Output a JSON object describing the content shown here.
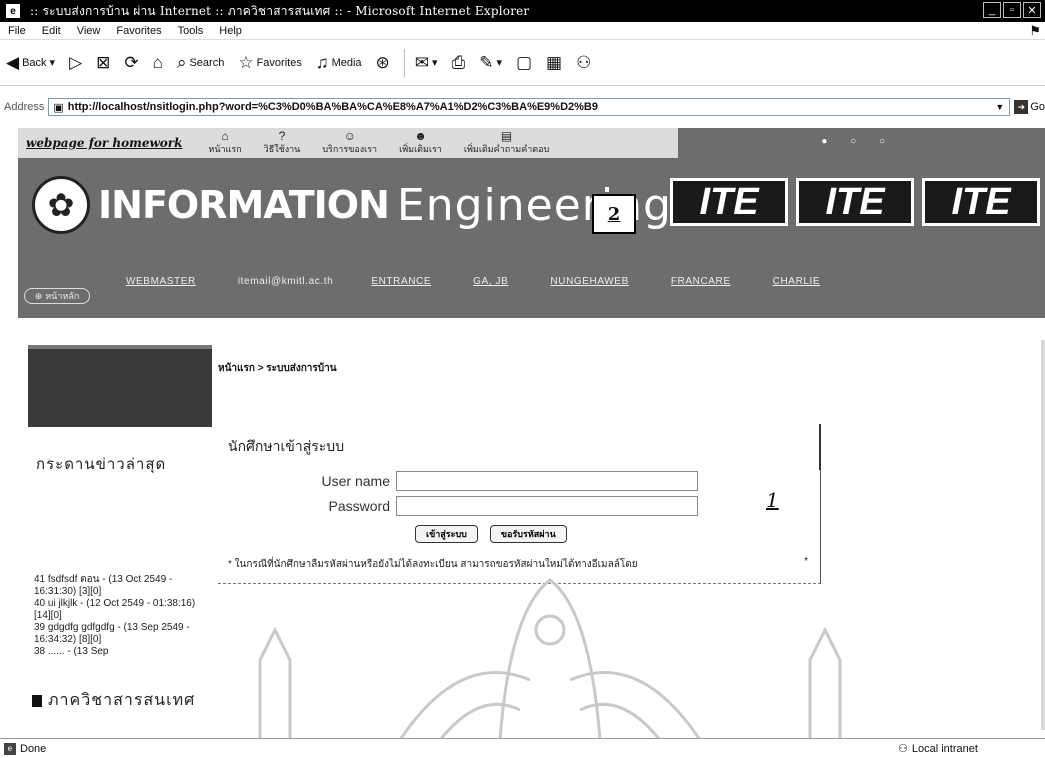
{
  "window": {
    "title": ":: ระบบส่งการบ้าน ผ่าน Internet :: ภาควิชาสารสนเทศ :: - Microsoft Internet Explorer",
    "app_icon_glyph": "e",
    "controls": [
      "_",
      "▫",
      "✕"
    ]
  },
  "menubar": {
    "items": [
      "File",
      "Edit",
      "View",
      "Favorites",
      "Tools",
      "Help"
    ]
  },
  "toolbar": {
    "back_label": "Back",
    "search_label": "Search",
    "favorites_label": "Favorites",
    "media_label": "Media"
  },
  "address": {
    "label": "Address",
    "url": "http://localhost/nsitlogin.php?word=%C3%D0%BA%BA%CA%E8%A7%A1%D2%C3%BA%E9%D2%B9",
    "go_label": "Go"
  },
  "banner": {
    "site_logo": "webpage for homework",
    "nav": [
      "หน้าแรก",
      "วิธีใช้งาน",
      "บริการของเรา",
      "เพิ่มเติมเรา",
      "เพิ่มเติมคำถามคำตอบ"
    ],
    "title_left": "INFORMATION",
    "title_right": "Engineering",
    "annotation_box": "2",
    "ite_blocks": [
      "ITE",
      "ITE",
      "ITE"
    ],
    "links": [
      "WEBMASTER",
      "ENTRANCE",
      "GA, JB",
      "NUNGEHAWEB",
      "FRANCARE",
      "CHARLIE"
    ],
    "email": "itemail@kmitl.ac.th",
    "main_button": "หน้าหลัก"
  },
  "breadcrumb": "หน้าแรก > ระบบส่งการบ้าน",
  "sidebar": {
    "news_heading": "กระดานข่าวล่าสุด",
    "news_items": [
      "41 fsdfsdf ตอน - (13 Oct 2549 - 16:31:30) [3][0]",
      "40 ui jlkjlk - (12 Oct 2549 - 01:38:16) [14][0]",
      "39 gdgdfg gdfgdfg - (13 Sep 2549 - 16:34:32) [8][0]",
      "38 ...... - (13 Sep"
    ],
    "department": "ภาควิชาสารสนเทศ"
  },
  "login": {
    "heading": "นักศึกษาเข้าสู่ระบบ",
    "username_label": "User name",
    "username_value": "",
    "password_label": "Password",
    "password_value": "",
    "login_button": "เข้าสู่ระบบ",
    "forgot_button": "ขอรับรหัสผ่าน",
    "notice": "* ในกรณีที่นักศึกษาลืมรหัสผ่านหรือยังไม่ได้ลงทะเบียน สามารถขอรหัสผ่านใหม่ได้ทางอีเมลล์โดย",
    "star": "*"
  },
  "annotation_1": "1",
  "statusbar": {
    "status": "Done",
    "zone": "Local intranet"
  }
}
